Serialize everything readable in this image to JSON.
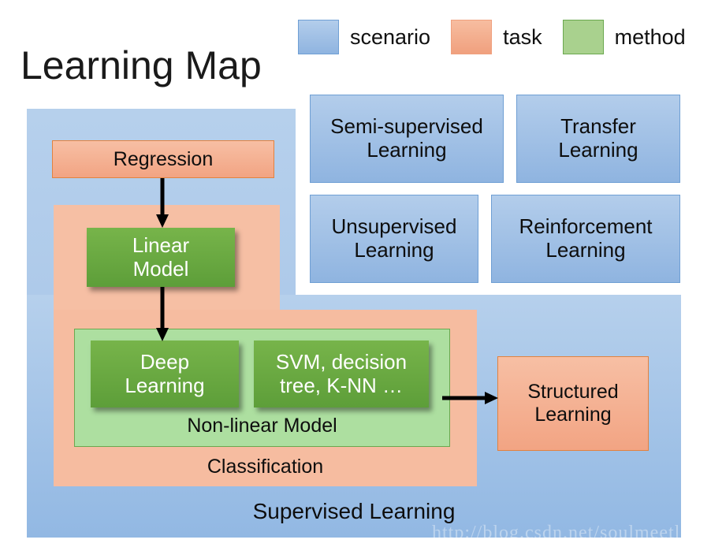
{
  "title": "Learning Map",
  "legend": {
    "items": [
      {
        "label": "scenario",
        "color": "#9cc0e6",
        "icon": "square-swatch-blue"
      },
      {
        "label": "task",
        "color": "#f4a582",
        "icon": "square-swatch-orange"
      },
      {
        "label": "method",
        "color": "#a9d18e",
        "icon": "square-swatch-green"
      }
    ]
  },
  "scenarios": {
    "semi_supervised": "Semi-supervised\nLearning",
    "semi_supervised_line1": "Semi-supervised",
    "semi_supervised_line2": "Learning",
    "transfer_line1": "Transfer",
    "transfer_line2": "Learning",
    "unsupervised_line1": "Unsupervised",
    "unsupervised_line2": "Learning",
    "reinforcement_line1": "Reinforcement",
    "reinforcement_line2": "Learning",
    "supervised_label": "Supervised Learning"
  },
  "tasks": {
    "regression": "Regression",
    "classification_label": "Classification",
    "structured_line1": "Structured",
    "structured_line2": "Learning"
  },
  "methods": {
    "linear_line1": "Linear",
    "linear_line2": "Model",
    "deep_line1": "Deep",
    "deep_line2": "Learning",
    "svm_line1": "SVM, decision",
    "svm_line2": "tree, K-NN …",
    "nonlinear_label": "Non-linear Model"
  },
  "watermark": "http://blog.csdn.net/soulmeetliang",
  "colors": {
    "scenario_fill": "#9cc0e6",
    "scenario_border": "#6f9fd4",
    "task_fill": "#f4a582",
    "task_border": "#e2823f",
    "method_fill": "#68a83f",
    "method_container_fill": "#addfa0",
    "method_container_border": "#6aa84f",
    "arrow": "#000000",
    "text_dark": "#0d0d0d",
    "text_light": "#ffffff"
  }
}
